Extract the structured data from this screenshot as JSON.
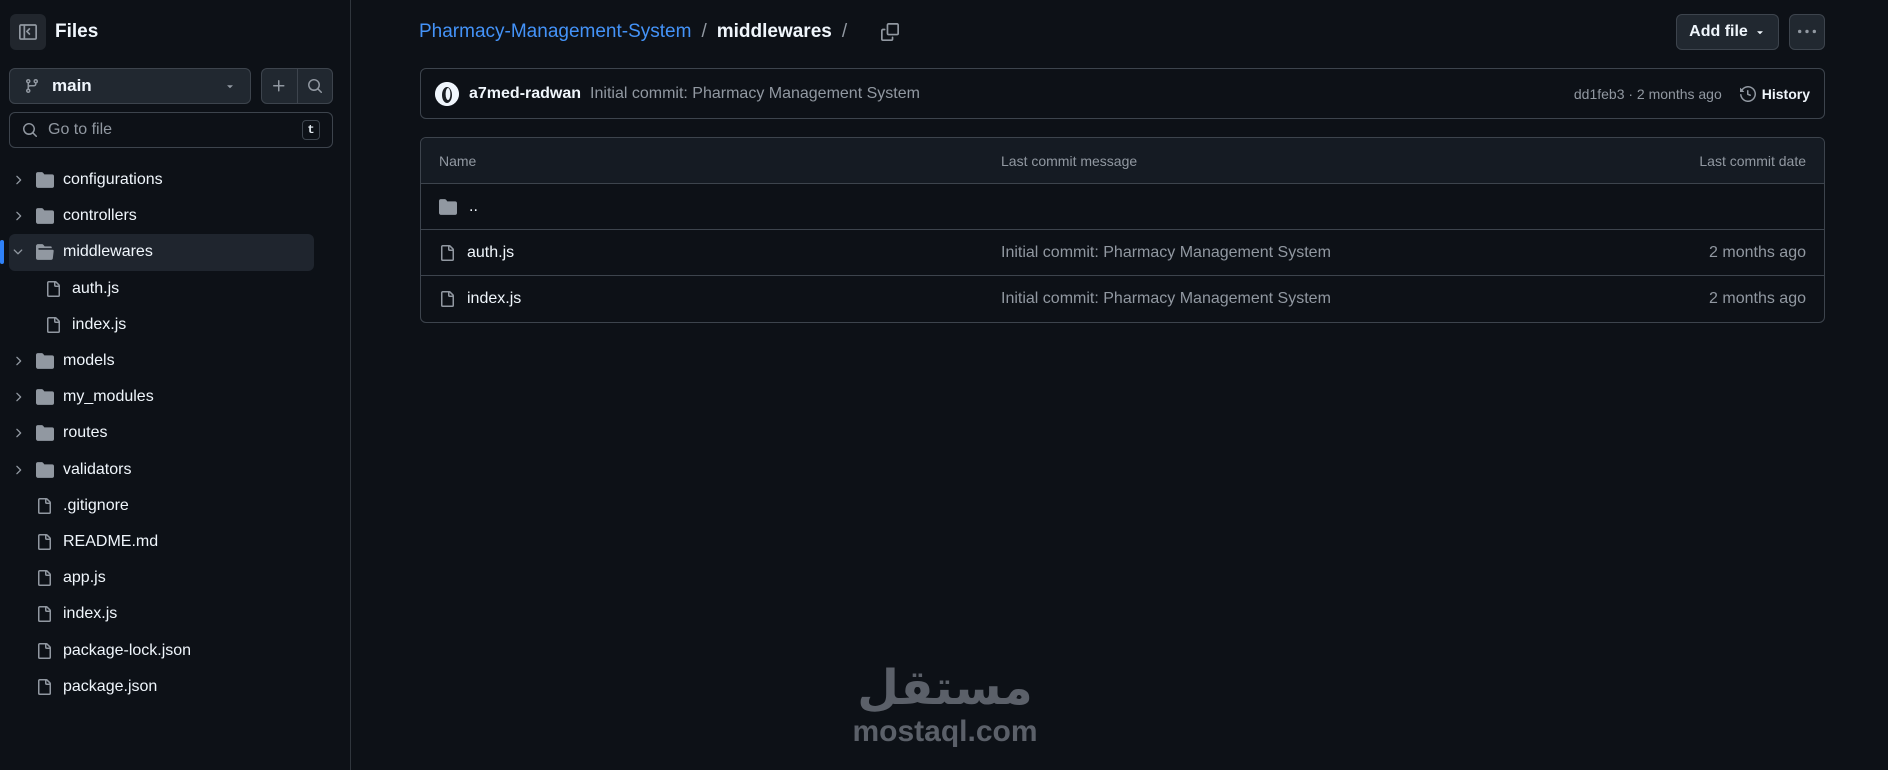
{
  "sidebar": {
    "title": "Files",
    "branch": "main",
    "search_placeholder": "Go to file",
    "search_shortcut": "t",
    "tree": [
      {
        "name": "configurations",
        "type": "folder"
      },
      {
        "name": "controllers",
        "type": "folder"
      },
      {
        "name": "middlewares",
        "type": "folder-open"
      },
      {
        "name": "auth.js",
        "type": "file"
      },
      {
        "name": "index.js",
        "type": "file"
      },
      {
        "name": "models",
        "type": "folder"
      },
      {
        "name": "my_modules",
        "type": "folder"
      },
      {
        "name": "routes",
        "type": "folder"
      },
      {
        "name": "validators",
        "type": "folder"
      },
      {
        "name": ".gitignore",
        "type": "file"
      },
      {
        "name": "README.md",
        "type": "file"
      },
      {
        "name": "app.js",
        "type": "file"
      },
      {
        "name": "index.js",
        "type": "file"
      },
      {
        "name": "package-lock.json",
        "type": "file"
      },
      {
        "name": "package.json",
        "type": "file"
      }
    ]
  },
  "breadcrumb": {
    "repo": "Pharmacy-Management-System",
    "separator": "/",
    "current": "middlewares",
    "trailing": "/"
  },
  "toolbar": {
    "add_file": "Add file"
  },
  "commit": {
    "author": "a7med-radwan",
    "message": "Initial commit: Pharmacy Management System",
    "meta": "dd1feb3 · 2 months ago",
    "history": "History"
  },
  "table": {
    "headers": {
      "name": "Name",
      "message": "Last commit message",
      "date": "Last commit date"
    },
    "parent": "..",
    "rows": [
      {
        "name": "auth.js",
        "message": "Initial commit: Pharmacy Management System",
        "date": "2 months ago"
      },
      {
        "name": "index.js",
        "message": "Initial commit: Pharmacy Management System",
        "date": "2 months ago"
      }
    ]
  },
  "watermark": {
    "arabic": "مستقل",
    "latin": "mostaql.com"
  },
  "colors": {
    "background": "#0d1117",
    "link": "#4493f8",
    "border": "#3d444d",
    "muted": "#9198a1",
    "active_indicator": "#2f81f7"
  }
}
